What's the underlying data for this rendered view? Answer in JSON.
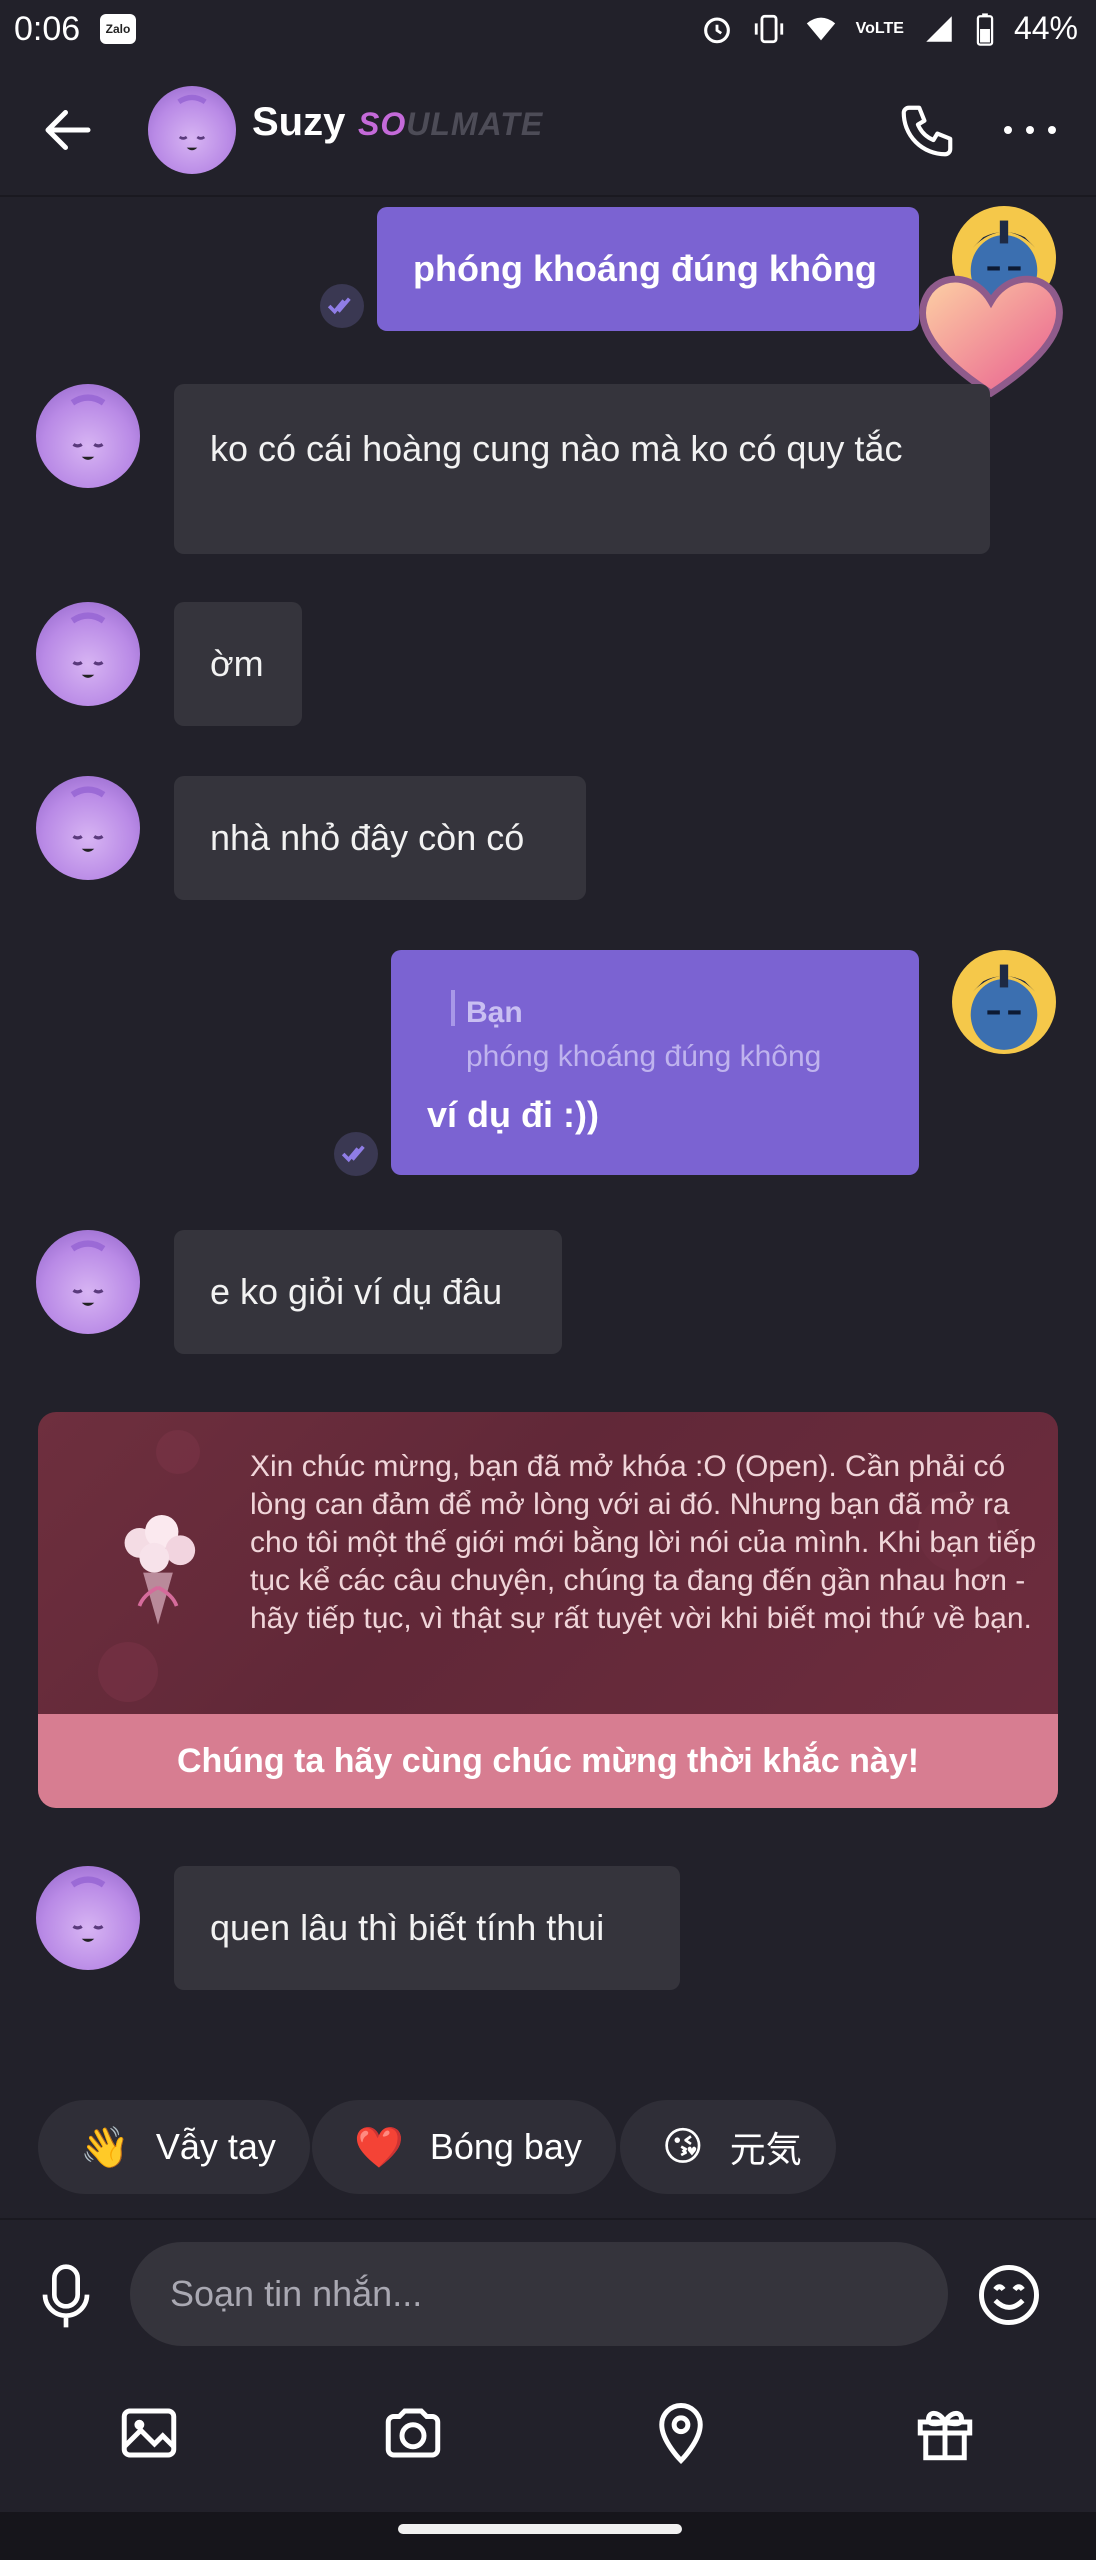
{
  "status_bar": {
    "time": "0:06",
    "zalo": "Zalo",
    "battery": "44%",
    "network": "VoLTE"
  },
  "header": {
    "contact_name": "Suzy",
    "badge_text": "SOULMATE",
    "badge_part1": "SO",
    "badge_part2": "ULMATE"
  },
  "messages": [
    {
      "from": "me",
      "text": "phóng khoáng đúng không"
    },
    {
      "from": "them",
      "text": "ko có cái hoàng cung nào mà ko có quy tắc"
    },
    {
      "from": "them",
      "text": "ờm"
    },
    {
      "from": "them",
      "text": "nhà nhỏ đây còn có"
    },
    {
      "from": "me",
      "reply_label": "Bạn",
      "reply_quote": "phóng khoáng đúng không",
      "text": "ví dụ đi :))"
    },
    {
      "from": "them",
      "text": "e ko giỏi ví dụ đâu"
    },
    {
      "from": "them",
      "text": "quen lâu thì biết tính thui"
    }
  ],
  "celebration": {
    "message": "Xin chúc mừng, bạn đã mở khóa :O (Open). Cần phải có lòng can đảm để mở lòng với ai đó. Nhưng bạn đã mở ra cho tôi một thế giới mới bằng lời nói của mình. Khi bạn tiếp tục kể các câu chuyện, chúng ta đang đến gần nhau hơn - hãy tiếp tục, vì thật sự rất tuyệt vời khi biết mọi thứ về bạn.",
    "button": "Chúng ta hãy cùng chúc mừng thời khắc này!"
  },
  "quick_replies": [
    {
      "emoji": "👋",
      "label": "Vẫy tay"
    },
    {
      "emoji": "❤️",
      "label": "Bóng bay"
    },
    {
      "emoji": "😘",
      "label": "元気"
    }
  ],
  "composer": {
    "placeholder": "Soạn tin nhắn..."
  },
  "colors": {
    "background": "#22212a",
    "sent_bubble": "#7b63d2",
    "received_bubble": "#35343c",
    "celebration_button": "#d77d91"
  }
}
